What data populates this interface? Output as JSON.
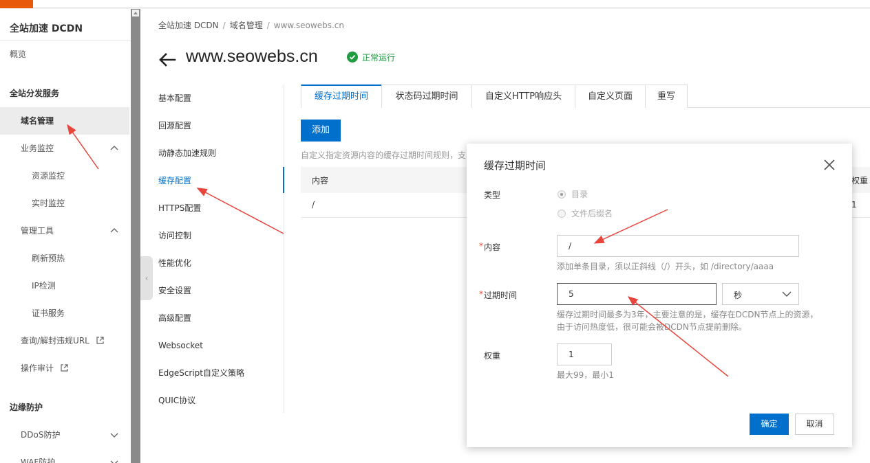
{
  "sidebar": {
    "title": "全站加速 DCDN",
    "items": [
      {
        "label": "概览"
      },
      {
        "label": "全站分发服务"
      },
      {
        "label": "域名管理"
      },
      {
        "label": "业务监控"
      },
      {
        "label": "资源监控"
      },
      {
        "label": "实时监控"
      },
      {
        "label": "管理工具"
      },
      {
        "label": "刷新预热"
      },
      {
        "label": "IP检测"
      },
      {
        "label": "证书服务"
      },
      {
        "label": "查询/解封违规URL"
      },
      {
        "label": "操作审计"
      },
      {
        "label": "边缘防护"
      },
      {
        "label": "DDoS防护"
      },
      {
        "label": "WAF防护"
      }
    ]
  },
  "breadcrumb": {
    "items": [
      "全站加速 DCDN",
      "域名管理",
      "www.seowebs.cn"
    ],
    "separator": "/"
  },
  "header": {
    "domain": "www.seowebs.cn",
    "status": "正常运行",
    "status_color": "#1f9b40"
  },
  "config_menu": {
    "items": [
      "基本配置",
      "回源配置",
      "动静态加速规则",
      "缓存配置",
      "HTTPS配置",
      "访问控制",
      "性能优化",
      "安全设置",
      "高级配置",
      "Websocket",
      "EdgeScript自定义策略",
      "QUIC协议"
    ],
    "active": "缓存配置"
  },
  "tabs": {
    "items": [
      "缓存过期时间",
      "状态码过期时间",
      "自定义HTTP响应头",
      "自定义页面",
      "重写"
    ],
    "active": "缓存过期时间"
  },
  "cache_panel": {
    "add_label": "添加",
    "description": "自定义指定资源内容的缓存过期时间规则，支",
    "columns": {
      "content": "内容",
      "weight": "权重"
    },
    "rows": [
      {
        "content": "/",
        "weight": "1"
      }
    ]
  },
  "modal": {
    "title": "缓存过期时间",
    "type_label": "类型",
    "type_options": [
      "目录",
      "文件后缀名"
    ],
    "type_selected": "目录",
    "content_label": "内容",
    "content_value": "/",
    "content_hint": "添加单条目录，须以正斜线（/）开头，如 /directory/aaaa",
    "expire_label": "过期时间",
    "expire_value": "5",
    "expire_unit": "秒",
    "expire_hint_1": "缓存过期时间最多为3年，主要注意的是，缓存在DCDN节点上的资源，",
    "expire_hint_2": "由于访问热度低，很可能会被DCDN节点提前删除。",
    "weight_label": "权重",
    "weight_value": "1",
    "weight_hint": "最大99，最小1",
    "ok_label": "确定",
    "cancel_label": "取消"
  },
  "colors": {
    "primary": "#0070cc",
    "annotation_arrow": "#e8453c",
    "required": "#e74c3c"
  }
}
